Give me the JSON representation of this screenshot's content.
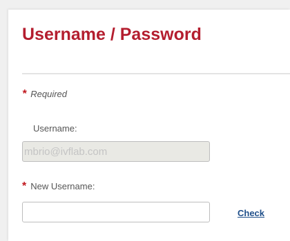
{
  "form": {
    "title": "Username / Password",
    "required_marker": "*",
    "required_note": "Required",
    "username_label": "Username:",
    "current_username_value": "mbrio@ivflab.com",
    "new_username_label": "New Username:",
    "new_username_value": "",
    "check_label": "Check"
  },
  "colors": {
    "title": "#b41e2f",
    "required_star": "#c0171e",
    "link": "#1f4f8a",
    "disabled_field_bg": "#e9e9e4"
  }
}
